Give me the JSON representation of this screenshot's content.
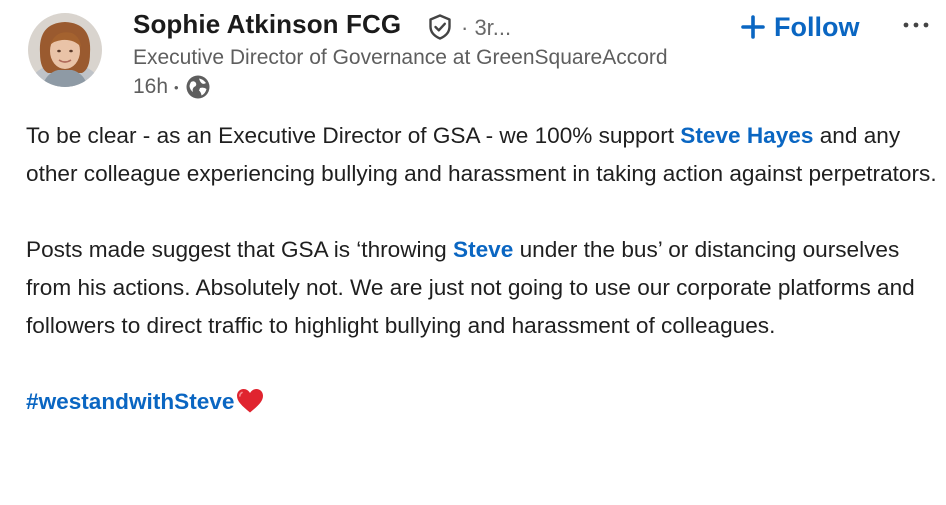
{
  "author": {
    "name": "Sophie Atkinson FCG",
    "connection_degree": "· 3r...",
    "headline": "Executive Director of Governance at GreenSquareAccord",
    "time_ago": "16h",
    "separator": "•",
    "visibility_icon": "globe-icon",
    "verified_icon": "verified-shield-icon"
  },
  "actions": {
    "follow_label": "Follow",
    "follow_icon": "plus-icon",
    "more_icon": "more-options-icon"
  },
  "post": {
    "paragraph1": {
      "text_a": "To be clear - as an Executive Director of GSA - we 100% support ",
      "mention_1": "Steve",
      "text_b": " ",
      "mention_2": "Hayes",
      "text_c": " and any other colleague experiencing bullying and harassment in taking action against perpetrators."
    },
    "paragraph2": {
      "text_a": "Posts made suggest that GSA is ‘throwing ",
      "mention": "Steve",
      "text_b": " under the bus’ or distancing ourselves from his actions. Absolutely not. We are just not going to use our corporate platforms and followers to direct traffic to highlight bullying and harassment of colleagues."
    },
    "hashtag": "#westandwithSteve",
    "hashtag_emoji": "red-heart-icon"
  },
  "colors": {
    "link": "#0a66c2",
    "text": "#1f1f1f",
    "secondary_text": "#5e5e5e",
    "heart": "#e0242f"
  }
}
